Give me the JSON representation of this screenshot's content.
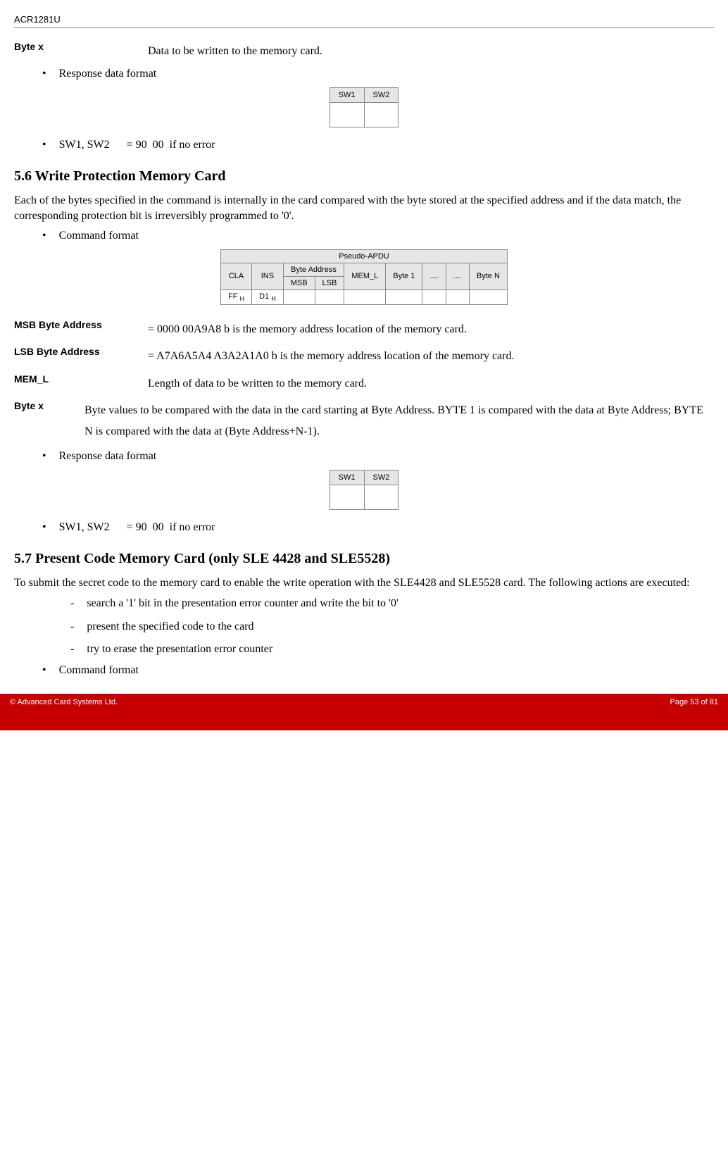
{
  "header": "ACR1281U",
  "top": {
    "byte_x_label": "Byte x",
    "byte_x_desc": "Data to be written to the memory card.",
    "response_data_format": "Response data format",
    "sw1": "SW1",
    "sw2": "SW2",
    "sw_line": "SW1, SW2      = 90  00  if no error"
  },
  "section56": {
    "heading": "5.6 Write Protection Memory Card",
    "para": "Each of the bytes specified in the command is internally in the card compared with the byte stored at the specified address and if the data match, the corresponding protection bit is irreversibly programmed to '0'.",
    "command_format": "Command format",
    "apdu": {
      "title": "Pseudo-APDU",
      "cla": "CLA",
      "ins": "INS",
      "byte_address": "Byte Address",
      "msb": "MSB",
      "lsb": "LSB",
      "mem_l": "MEM_L",
      "byte1": "Byte 1",
      "dots": "....",
      "byten": "Byte N",
      "ff": "FF",
      "h": "H",
      "d1": "D1"
    },
    "msb_label": "MSB Byte Address",
    "msb_desc": "= 0000 00A9A8 b is the memory address location of the memory card.",
    "lsb_label": "LSB Byte Address",
    "lsb_desc": "= A7A6A5A4 A3A2A1A0 b is the memory address location of the memory card.",
    "meml_label": "MEM_L",
    "meml_desc": "Length of data to be written to the memory card.",
    "bytex_label": "Byte x",
    "bytex_desc": "Byte values to be compared with the data in the card starting at Byte Address. BYTE 1 is compared with the data at Byte Address; BYTE N is compared with the data at (Byte Address+N-1).",
    "response_data_format": "Response data format",
    "sw_line": "SW1, SW2      = 90  00  if no error"
  },
  "section57": {
    "heading": "5.7 Present Code Memory Card (only SLE 4428 and SLE5528)",
    "para": "To submit the secret code to the memory card to enable the write operation with the SLE4428 and SLE5528 card. The following actions are executed:",
    "dash1": "search a '1' bit in the presentation error counter and write the bit to '0'",
    "dash2": "present the specified code to the card",
    "dash3": "try to erase the presentation error counter",
    "command_format": "Command format"
  },
  "footer": {
    "left": "© Advanced Card Systems Ltd.",
    "right": "Page 53 of 81"
  }
}
